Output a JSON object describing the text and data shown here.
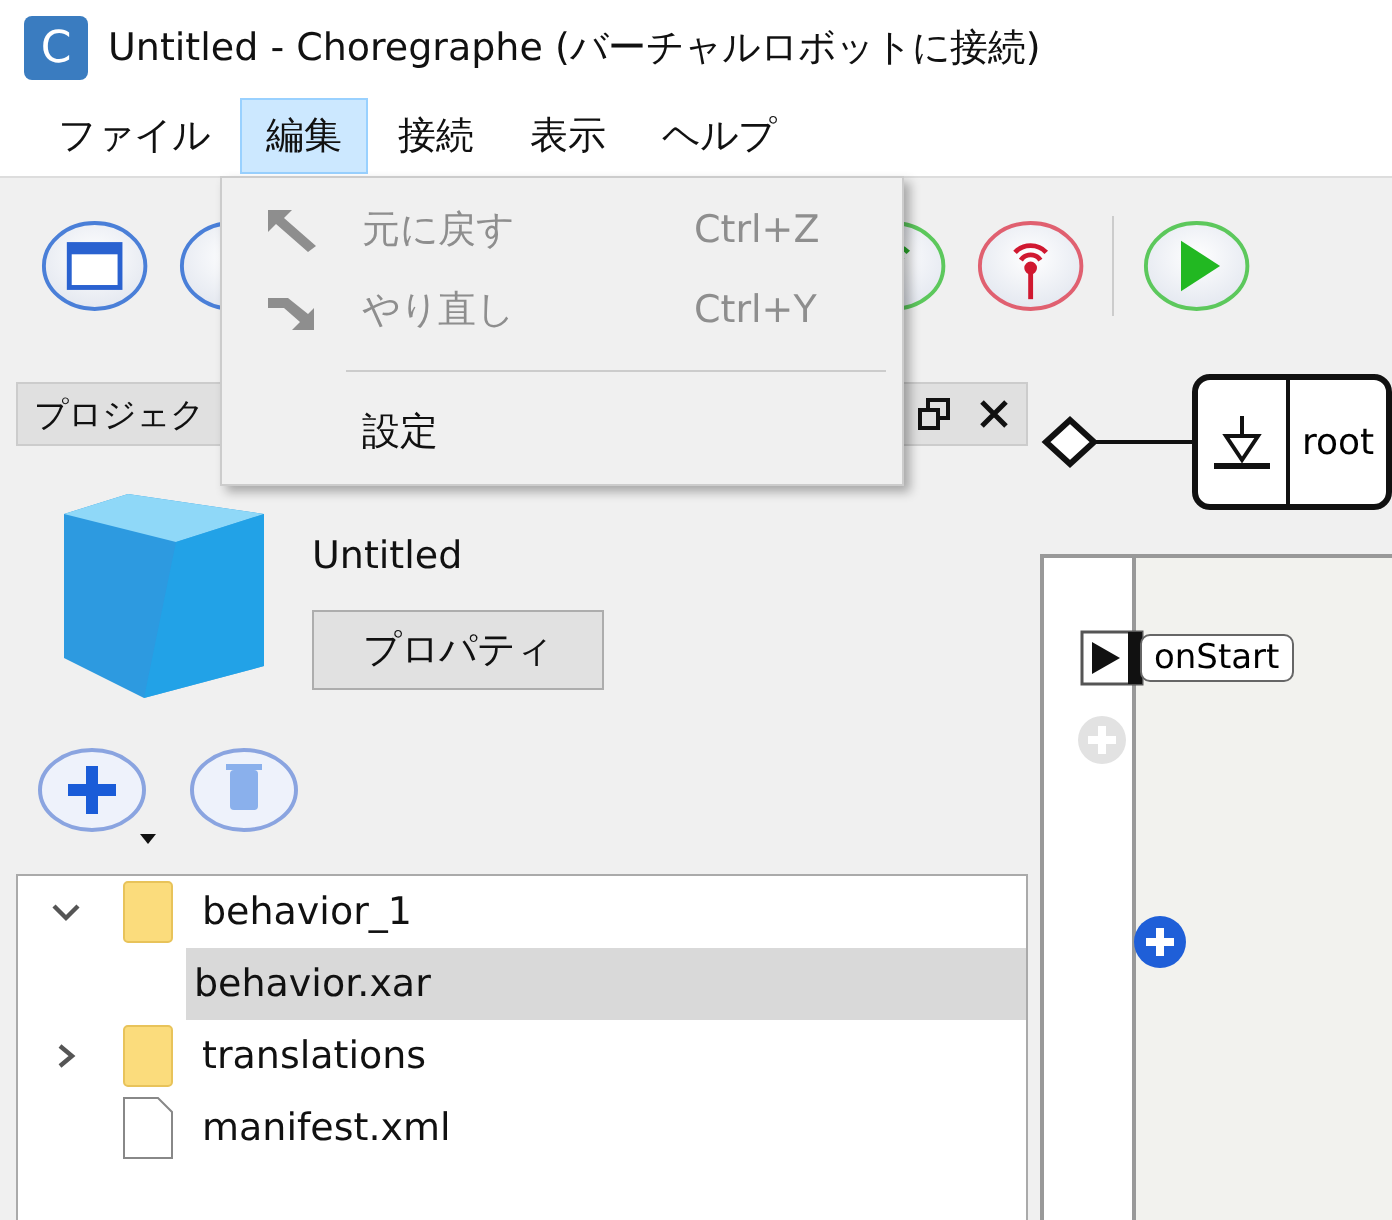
{
  "window": {
    "app_icon_letter": "C",
    "title": "Untitled - Choregraphe (バーチャルロボットに接続)"
  },
  "menu_bar": [
    {
      "label": "ファイル",
      "selected": false
    },
    {
      "label": "編集",
      "selected": true
    },
    {
      "label": "接続",
      "selected": false
    },
    {
      "label": "表示",
      "selected": false
    },
    {
      "label": "ヘルプ",
      "selected": false
    }
  ],
  "open_menu": {
    "items": [
      {
        "kind": "command",
        "label": "元に戻す",
        "shortcut": "Ctrl+Z",
        "disabled": true
      },
      {
        "kind": "command",
        "label": "やり直し",
        "shortcut": "Ctrl+Y",
        "disabled": true
      },
      {
        "kind": "separator"
      },
      {
        "kind": "command",
        "label": "設定",
        "disabled": false
      }
    ]
  },
  "project_panel": {
    "title": "プロジェク",
    "project_name": "Untitled",
    "properties_button": "プロパティ",
    "tree": [
      {
        "kind": "folder",
        "label": "behavior_1",
        "expanded": true,
        "selected": false,
        "children": [
          {
            "label": "behavior.xar",
            "selected": true
          }
        ]
      },
      {
        "kind": "folder",
        "label": "translations",
        "expanded": false,
        "selected": false
      },
      {
        "kind": "document",
        "label": "manifest.xml",
        "selected": false
      }
    ]
  },
  "diagram": {
    "root_label": "root",
    "inputs": [
      {
        "label": "onStart"
      }
    ]
  }
}
